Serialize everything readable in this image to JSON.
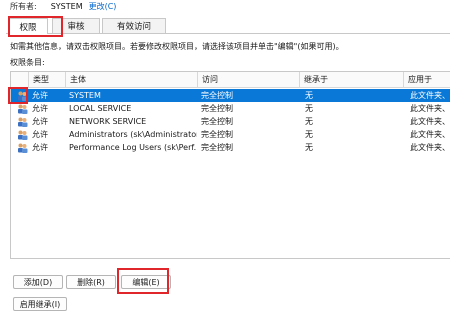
{
  "owner": {
    "label": "所有者:",
    "value": "SYSTEM",
    "change_link": "更改(C)"
  },
  "tabs": [
    {
      "label": "权限",
      "active": true
    },
    {
      "label": "审核",
      "active": false
    },
    {
      "label": "有效访问",
      "active": false
    }
  ],
  "instruction": "如需其他信息，请双击权限项目。若要修改权限项目，请选择该项目并单击\"编辑\"(如果可用)。",
  "entries_label": "权限条目:",
  "table": {
    "columns": [
      "类型",
      "主体",
      "访问",
      "继承于",
      "应用于"
    ],
    "rows": [
      {
        "type": "允许",
        "principal": "SYSTEM",
        "access": "完全控制",
        "inherited": "无",
        "applies": "此文件夹、子",
        "selected": true
      },
      {
        "type": "允许",
        "principal": "LOCAL SERVICE",
        "access": "完全控制",
        "inherited": "无",
        "applies": "此文件夹、子",
        "selected": false
      },
      {
        "type": "允许",
        "principal": "NETWORK SERVICE",
        "access": "完全控制",
        "inherited": "无",
        "applies": "此文件夹、子",
        "selected": false
      },
      {
        "type": "允许",
        "principal": "Administrators (sk\\Administrator...",
        "access": "完全控制",
        "inherited": "无",
        "applies": "此文件夹、子",
        "selected": false
      },
      {
        "type": "允许",
        "principal": "Performance Log Users (sk\\Perf...",
        "access": "完全控制",
        "inherited": "无",
        "applies": "此文件夹、子",
        "selected": false
      }
    ]
  },
  "buttons": {
    "add": "添加(D)",
    "remove": "删除(R)",
    "edit": "编辑(E)",
    "enable_inheritance": "启用继承(I)"
  },
  "colors": {
    "highlight": "#e0262a",
    "selection": "#0a78d7",
    "link": "#0066cc"
  },
  "icons": [
    "user-group-icon"
  ]
}
